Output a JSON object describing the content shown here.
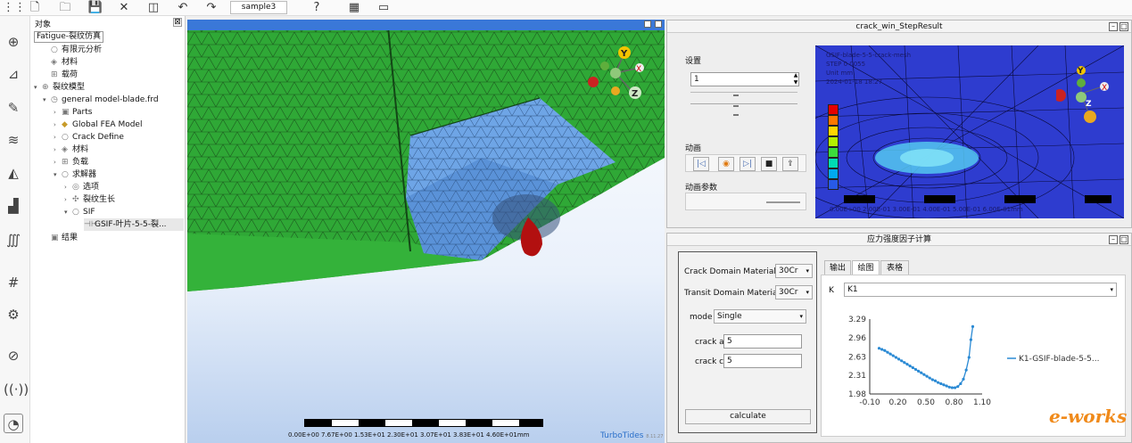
{
  "toolbar": {
    "file_name": "sample3"
  },
  "tree": {
    "title": "对象",
    "close": "⊠",
    "tab": "Fatigue-裂纹仿真",
    "nodes": [
      {
        "label": "有限元分析"
      },
      {
        "label": "材料"
      },
      {
        "label": "载荷"
      },
      {
        "label": "裂纹模型"
      },
      {
        "label": "general model-blade.frd"
      },
      {
        "label": "Parts"
      },
      {
        "label": "Global FEA Model"
      },
      {
        "label": "Crack Define"
      },
      {
        "label": "材料"
      },
      {
        "label": "负载"
      },
      {
        "label": "求解器"
      },
      {
        "label": "选项"
      },
      {
        "label": "裂纹生长"
      },
      {
        "label": "SIF"
      },
      {
        "label": "GSIF-叶片-5-5-裂..."
      },
      {
        "label": "结果"
      }
    ]
  },
  "viewport": {
    "axes": {
      "x": "X",
      "y": "Y",
      "z": "Z"
    },
    "scale_labels": "0.00E+00 7.67E+00 1.53E+01 2.30E+01 3.07E+01 3.83E+01 4.60E+01mm",
    "brand": "TurboTides",
    "brand_version": "8.11.27",
    "colors": {
      "mesh_green": "#2fa836",
      "mesh_blue": "#6ea5e6",
      "crack_red": "#b21010"
    }
  },
  "step_panel": {
    "title": "crack_win_StepResult",
    "settings_label": "设置",
    "step_value": "1",
    "animation_label": "动画",
    "animation_params_label": "动画参数",
    "result_text": [
      "GSIF-blade-5-5-crack-mesh",
      "STEP 0 0055",
      "Unit mm",
      "2024-01-18 18:27"
    ],
    "axes": {
      "x": "X",
      "y": "Y",
      "z": "Z"
    },
    "scale_labels": "0.00E+00  2.00E-01  3.00E-01  4.00E-01  5.00E-01  6.00E-01mm",
    "legend_colors": [
      "#e60000",
      "#ff7800",
      "#ffd700",
      "#b4f000",
      "#3cdc3c",
      "#00dcb4",
      "#00aaf0",
      "#285ae6"
    ]
  },
  "sif_panel": {
    "title": "应力强度因子计算",
    "crack_domain_label": "Crack Domain Material",
    "crack_domain_value": "30Cr",
    "transit_domain_label": "Transit Domain Material",
    "transit_domain_value": "30Cr",
    "mode_label": "mode",
    "mode_value": "Single",
    "crack_a_label": "crack a",
    "crack_a_value": "5",
    "crack_c_label": "crack c",
    "crack_c_value": "5",
    "calculate_label": "calculate",
    "tabs": [
      "输出",
      "绘图",
      "表格"
    ],
    "k_label": "K",
    "k_value": "K1"
  },
  "chart_data": {
    "type": "line",
    "title": "",
    "xlabel": "",
    "ylabel": "",
    "xlim": [
      -0.1,
      1.1
    ],
    "ylim": [
      1.98,
      3.29
    ],
    "xticks": [
      "-0.10",
      "0.20",
      "0.50",
      "0.80",
      "1.10"
    ],
    "yticks": [
      "3.29",
      "2.96",
      "2.63",
      "2.31",
      "1.98"
    ],
    "series": [
      {
        "name": "K1-GSIF-blade-5-5...",
        "color": "#2b8ad4",
        "x": [
          0.0,
          0.03,
          0.06,
          0.09,
          0.12,
          0.15,
          0.18,
          0.21,
          0.24,
          0.27,
          0.3,
          0.33,
          0.36,
          0.39,
          0.42,
          0.45,
          0.48,
          0.51,
          0.54,
          0.57,
          0.6,
          0.63,
          0.66,
          0.69,
          0.72,
          0.75,
          0.78,
          0.81,
          0.84,
          0.87,
          0.9,
          0.93,
          0.96,
          0.98,
          1.0
        ],
        "y": [
          2.78,
          2.76,
          2.74,
          2.71,
          2.68,
          2.65,
          2.62,
          2.59,
          2.56,
          2.53,
          2.5,
          2.47,
          2.44,
          2.41,
          2.38,
          2.35,
          2.32,
          2.29,
          2.26,
          2.23,
          2.21,
          2.18,
          2.16,
          2.14,
          2.12,
          2.1,
          2.09,
          2.09,
          2.11,
          2.16,
          2.24,
          2.4,
          2.62,
          2.93,
          3.16
        ]
      }
    ],
    "legend": "right"
  }
}
